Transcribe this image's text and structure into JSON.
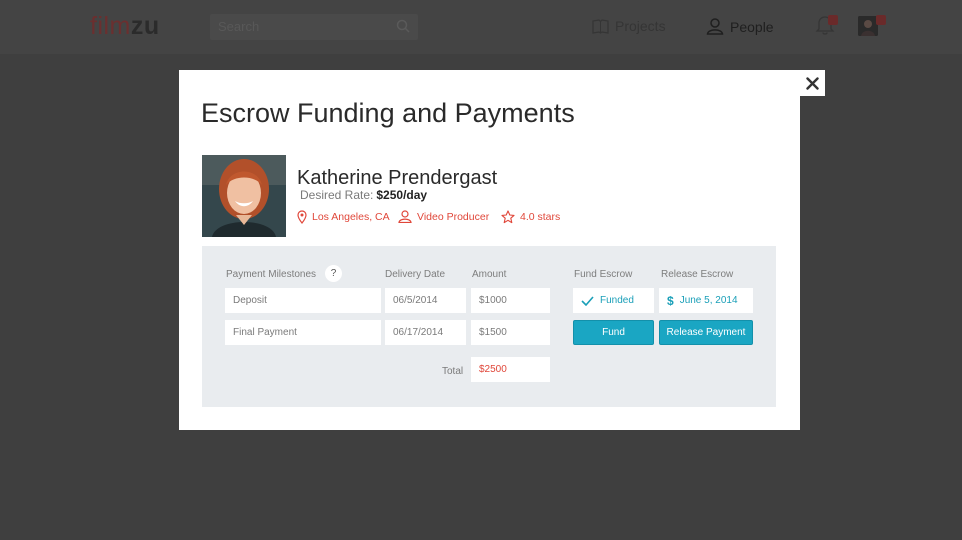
{
  "app": {
    "logo_part1": "film",
    "logo_part2": "zu",
    "search_placeholder": "Search",
    "nav_projects": "Projects",
    "nav_people": "People"
  },
  "modal": {
    "title": "Escrow Funding and Payments",
    "close_label": "✕"
  },
  "profile": {
    "name": "Katherine Prendergast",
    "rate_label": "Desired Rate:",
    "rate_value": "$250/day",
    "location": "Los Angeles, CA",
    "role": "Video Producer",
    "rating": "4.0 stars"
  },
  "milestones": {
    "headers": {
      "milestones": "Payment Milestones",
      "help": "?",
      "delivery": "Delivery Date",
      "amount": "Amount",
      "fund": "Fund Escrow",
      "release": "Release Escrow"
    },
    "rows": [
      {
        "name": "Deposit",
        "date": "06/5/2014",
        "amount": "$1000",
        "fund_status": "Funded",
        "release_status": "June 5, 2014"
      },
      {
        "name": "Final Payment",
        "date": "06/17/2014",
        "amount": "$1500",
        "fund_button": "Fund",
        "release_button": "Release Payment"
      }
    ],
    "total_label": "Total",
    "total_value": "$2500"
  },
  "colors": {
    "accent_red": "#e0473a",
    "accent_teal": "#1aa6c3",
    "overlay": "#3f3f3f"
  }
}
